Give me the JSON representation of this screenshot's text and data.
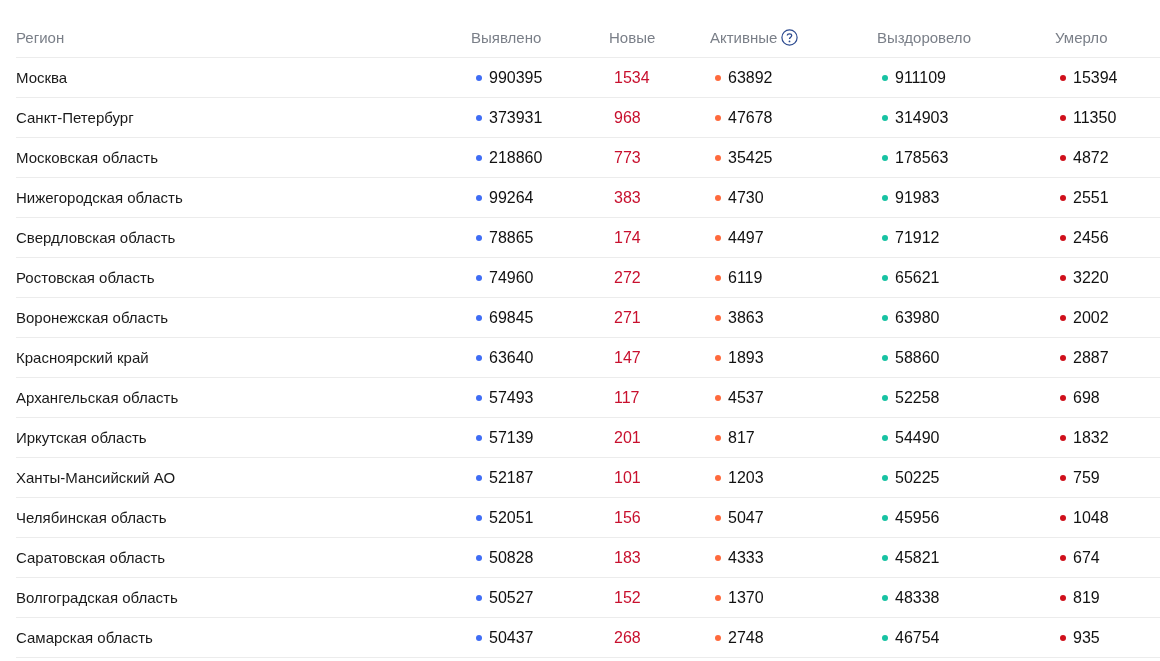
{
  "table": {
    "columns": [
      {
        "label": "Регион",
        "kind": "region"
      },
      {
        "label": "Выявлено",
        "kind": "dot",
        "color": "#3f6df5"
      },
      {
        "label": "Новые",
        "kind": "new"
      },
      {
        "label": "Активные",
        "kind": "dot",
        "color": "#ff6a3c",
        "help": true
      },
      {
        "label": "Выздоровело",
        "kind": "dot",
        "color": "#17c3a3"
      },
      {
        "label": "Умерло",
        "kind": "dot",
        "color": "#d0101b"
      }
    ],
    "rows": [
      {
        "cells": [
          "Москва",
          "990395",
          "1534",
          "63892",
          "911109",
          "15394"
        ]
      },
      {
        "cells": [
          "Санкт-Петербург",
          "373931",
          "968",
          "47678",
          "314903",
          "11350"
        ]
      },
      {
        "cells": [
          "Московская область",
          "218860",
          "773",
          "35425",
          "178563",
          "4872"
        ]
      },
      {
        "cells": [
          "Нижегородская область",
          "99264",
          "383",
          "4730",
          "91983",
          "2551"
        ]
      },
      {
        "cells": [
          "Свердловская область",
          "78865",
          "174",
          "4497",
          "71912",
          "2456"
        ]
      },
      {
        "cells": [
          "Ростовская область",
          "74960",
          "272",
          "6119",
          "65621",
          "3220"
        ]
      },
      {
        "cells": [
          "Воронежская область",
          "69845",
          "271",
          "3863",
          "63980",
          "2002"
        ]
      },
      {
        "cells": [
          "Красноярский край",
          "63640",
          "147",
          "1893",
          "58860",
          "2887"
        ]
      },
      {
        "cells": [
          "Архангельская область",
          "57493",
          "117",
          "4537",
          "52258",
          "698"
        ]
      },
      {
        "cells": [
          "Иркутская область",
          "57139",
          "201",
          "817",
          "54490",
          "1832"
        ]
      },
      {
        "cells": [
          "Ханты-Мансийский АО",
          "52187",
          "101",
          "1203",
          "50225",
          "759"
        ]
      },
      {
        "cells": [
          "Челябинская область",
          "52051",
          "156",
          "5047",
          "45956",
          "1048"
        ]
      },
      {
        "cells": [
          "Саратовская область",
          "50828",
          "183",
          "4333",
          "45821",
          "674"
        ]
      },
      {
        "cells": [
          "Волгоградская область",
          "50527",
          "152",
          "1370",
          "48338",
          "819"
        ]
      },
      {
        "cells": [
          "Самарская область",
          "50437",
          "268",
          "2748",
          "46754",
          "935"
        ]
      }
    ]
  }
}
